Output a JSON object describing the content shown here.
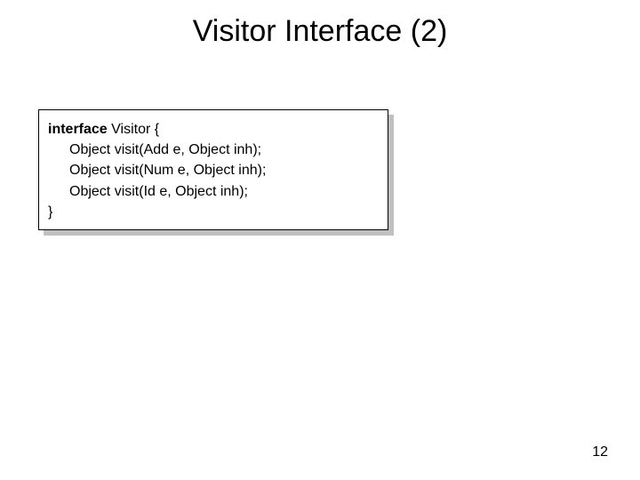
{
  "title": "Visitor Interface (2)",
  "code": {
    "kw": "interface",
    "decl": " Visitor {",
    "line1": "Object visit(Add e, Object inh);",
    "line2": "Object visit(Num e, Object inh);",
    "line3": "Object visit(Id e, Object inh);",
    "close": "}"
  },
  "pageNumber": "12"
}
